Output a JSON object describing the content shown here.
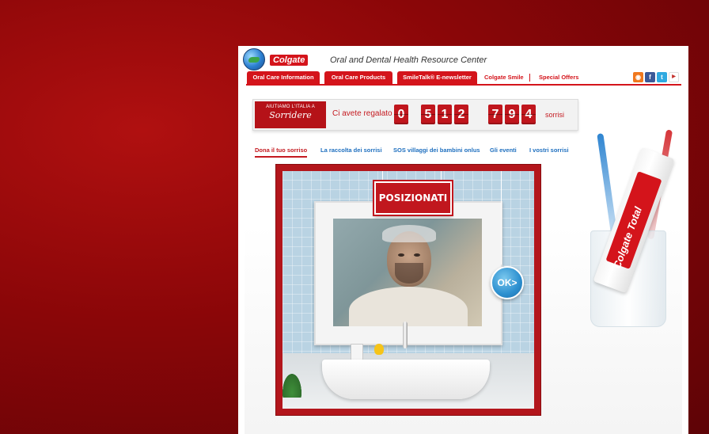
{
  "header": {
    "brand": "Colgate",
    "site_title": "Oral and Dental Health Resource Center"
  },
  "nav": {
    "tabs": [
      "Oral Care Information",
      "Oral Care Products",
      "SmileTalk® E-newsletter"
    ],
    "links": [
      "Colgate Smile",
      "Special Offers"
    ],
    "social": [
      "rss-icon",
      "facebook-icon",
      "twitter-icon",
      "youtube-icon"
    ]
  },
  "counter": {
    "logo_line1": "AIUTIAMO L'ITALIA A",
    "logo_line2": "Sorridere",
    "label": "Ci avete regalato",
    "digits": [
      "0",
      "5",
      "1",
      "2",
      "7",
      "9",
      "4"
    ],
    "unit": "sorrisi"
  },
  "subnav": {
    "items": [
      "Dona il tuo sorriso",
      "La raccolta dei sorrisi",
      "SOS villaggi dei bambini onlus",
      "Gli eventi",
      "I vostri sorrisi"
    ],
    "active_index": 0
  },
  "stage": {
    "tag": "POSIZIONATI",
    "ok_button": "OK>"
  },
  "product": {
    "tube_text": "Colgate Total"
  },
  "colors": {
    "brand_red": "#d4141b",
    "link_blue": "#1e6fbf"
  }
}
